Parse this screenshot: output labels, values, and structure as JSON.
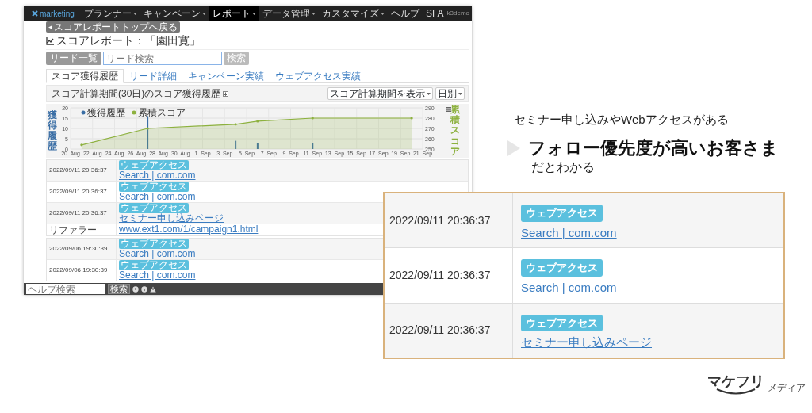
{
  "screen": {
    "nav": {
      "logo": "marketing",
      "user": "k3demo",
      "items": [
        {
          "label": "プランナー",
          "dropdown": true,
          "selected": false
        },
        {
          "label": "キャンペーン",
          "dropdown": true,
          "selected": false
        },
        {
          "label": "レポート",
          "dropdown": true,
          "selected": true
        },
        {
          "label": "データ管理",
          "dropdown": true,
          "selected": false
        },
        {
          "label": "カスタマイズ",
          "dropdown": true,
          "selected": false
        },
        {
          "label": "ヘルプ",
          "dropdown": false,
          "selected": false
        },
        {
          "label": "SFA",
          "dropdown": false,
          "selected": false
        }
      ]
    },
    "back_link": "スコアレポートトップへ戻る",
    "title": "スコアレポート：「園田寛」",
    "search": {
      "button": "リード一覧",
      "placeholder": "リード検索",
      "submit": "検索"
    },
    "tabs": [
      {
        "label": "スコア獲得履歴",
        "selected": true
      },
      {
        "label": "リード詳細",
        "selected": false
      },
      {
        "label": "キャンペーン実績",
        "selected": false
      },
      {
        "label": "ウェブアクセス実績",
        "selected": false
      }
    ],
    "section": {
      "title": "スコア計算期間(30日)のスコア獲得履歴",
      "selects": [
        "スコア計算期間を表示",
        "日別"
      ]
    },
    "bar_chart": {
      "chart_data": {
        "type": "bar",
        "ylabel": "獲得履歴",
        "grid": true,
        "ylim": [
          0,
          20
        ],
        "yticks": [
          0,
          5,
          10,
          15,
          20
        ],
        "categories": [
          "20. Aug",
          null,
          "22. Aug",
          null,
          "24. Aug",
          null,
          "26. Aug",
          null,
          "28. Aug",
          null,
          "30. Aug",
          null,
          "1. Sep",
          null,
          "3. Sep",
          null,
          "5. Sep",
          null,
          "7. Sep",
          null,
          "9. Sep",
          null,
          "11. Sep",
          null,
          "13. Sep",
          null,
          "15. Sep",
          null,
          "17. Sep",
          null,
          "19. Sep",
          null,
          "21. Sep"
        ],
        "series": [
          {
            "name": "獲得履歴",
            "color": "#3a6ea5",
            "values": [
              null,
              null,
              null,
              null,
              null,
              null,
              null,
              16,
              null,
              null,
              null,
              null,
              null,
              null,
              null,
              4,
              null,
              3,
              null,
              null,
              null,
              null,
              3,
              null,
              null,
              null,
              null,
              null,
              null,
              null,
              null,
              null,
              null
            ]
          }
        ]
      }
    },
    "score_chart": {
      "chart_data": {
        "type": "area",
        "ylabel": "累積スコア",
        "ylim": [
          250,
          290
        ],
        "yticks": [
          250,
          260,
          270,
          280,
          290
        ],
        "series": [
          {
            "name": "累積スコア",
            "color": "#8db13f",
            "values": [
              null,
              254,
              null,
              null,
              null,
              null,
              null,
              270,
              null,
              null,
              null,
              null,
              null,
              null,
              null,
              274,
              null,
              277,
              null,
              null,
              null,
              null,
              280,
              null,
              null,
              null,
              null,
              null,
              null,
              null,
              null,
              280,
              null
            ]
          }
        ]
      }
    },
    "history": [
      {
        "rows": [
          {
            "time": "2022/09/11 20:36:37",
            "tag": "ウェブアクセス",
            "link": "Search | com.com"
          },
          {
            "time": "2022/09/11 20:36:37",
            "tag": "ウェブアクセス",
            "link": "Search | com.com"
          },
          {
            "time": "2022/09/11 20:36:37",
            "tag": "ウェブアクセス",
            "link": "セミナー申し込みページ"
          },
          {
            "time": "リファラー",
            "link": "www.ext1.com/1/campaign1.html"
          }
        ]
      },
      {
        "rows": [
          {
            "time": "2022/09/06 19:30:39",
            "tag": "ウェブアクセス",
            "link": "Search | com.com"
          },
          {
            "time": "2022/09/06 19:30:39",
            "tag": "ウェブアクセス",
            "link": "Search | com.com"
          }
        ]
      }
    ],
    "footer": {
      "placeholder": "ヘルプ検索",
      "button": "検索"
    }
  },
  "callout": {
    "lead": "セミナー申し込みやWebアクセスがある",
    "headline": "フォロー優先度が高いお客さま",
    "tail": "だとわかる"
  },
  "zoom_panel": {
    "rows": [
      {
        "time": "2022/09/11 20:36:37",
        "tag": "ウェブアクセス",
        "link": "Search | com.com"
      },
      {
        "time": "2022/09/11 20:36:37",
        "tag": "ウェブアクセス",
        "link": "Search | com.com"
      },
      {
        "time": "2022/09/11 20:36:37",
        "tag": "ウェブアクセス",
        "link": "セミナー申し込みページ"
      }
    ]
  },
  "brand": {
    "logo": "マケフリ",
    "sub": "メディア"
  }
}
